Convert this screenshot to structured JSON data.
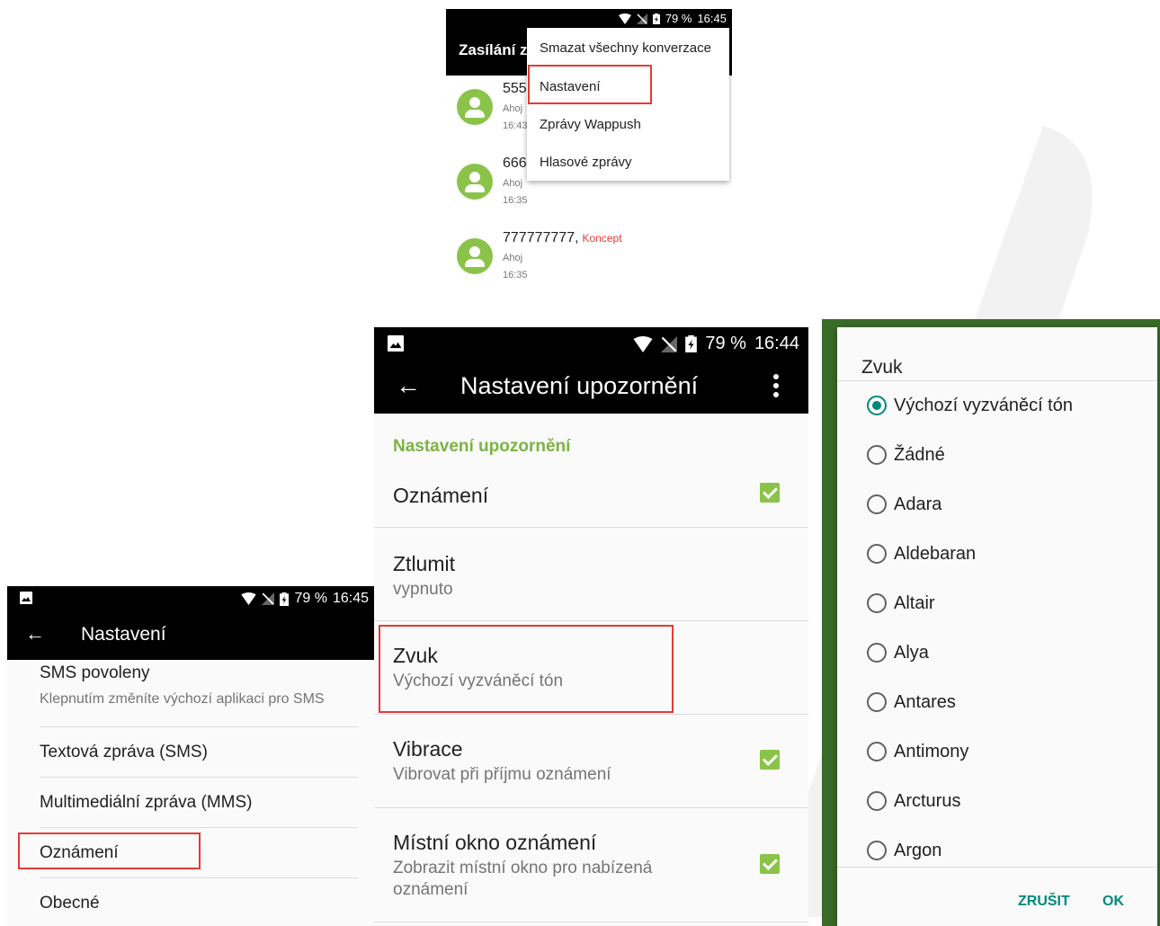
{
  "status": {
    "battery": "79 %",
    "time_a": "16:45",
    "time_b": "16:44"
  },
  "messages": {
    "title": "Zasílání z",
    "conversations": [
      {
        "number": "555",
        "preview": "Ahoj",
        "time": "16:43"
      },
      {
        "number": "666",
        "preview": "Ahoj",
        "time": "16:35"
      },
      {
        "number": "777777777,",
        "draft": "Koncept",
        "preview": "Ahoj",
        "time": "16:35"
      }
    ],
    "menu": [
      "Smazat všechny konverzace",
      "Nastavení",
      "Zprávy Wappush",
      "Hlasové zprávy"
    ]
  },
  "settings": {
    "back": "←",
    "title": "Nastavení",
    "rows": [
      {
        "title": "SMS povoleny",
        "subtitle": "Klepnutím změníte výchozí aplikaci pro SMS"
      },
      {
        "title": "Textová zpráva (SMS)"
      },
      {
        "title": "Multimediální zpráva (MMS)"
      },
      {
        "title": "Oznámení"
      },
      {
        "title": "Obecné"
      }
    ]
  },
  "notif": {
    "back": "←",
    "title": "Nastavení upozornění",
    "section": "Nastavení upozornění",
    "rows": [
      {
        "title": "Oznámení",
        "checked": true
      },
      {
        "title": "Ztlumit",
        "subtitle": "vypnuto"
      },
      {
        "title": "Zvuk",
        "subtitle": "Výchozí vyzváněcí tón"
      },
      {
        "title": "Vibrace",
        "subtitle": "Vibrovat při příjmu oznámení",
        "checked": true
      },
      {
        "title": "Místní okno oznámení",
        "subtitle": "Zobrazit místní okno pro nabízená oznámení",
        "checked": true
      }
    ]
  },
  "dialog": {
    "title": "Zvuk",
    "options": [
      "Výchozí vyzváněcí tón",
      "Žádné",
      "Adara",
      "Aldebaran",
      "Altair",
      "Alya",
      "Antares",
      "Antimony",
      "Arcturus",
      "Argon"
    ],
    "selected": "Výchozí vyzváněcí tón",
    "cancel": "ZRUŠIT",
    "ok": "OK"
  },
  "colors": {
    "accent_green": "#8bc34a",
    "teal": "#00897b",
    "highlight_red": "#e53935"
  }
}
